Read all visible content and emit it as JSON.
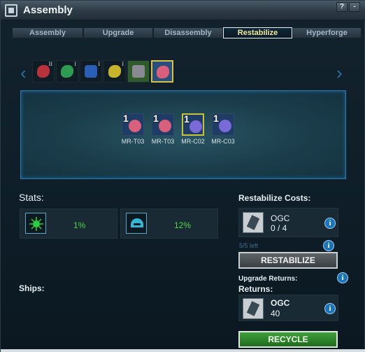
{
  "window": {
    "title": "Assembly",
    "help_label": "?",
    "minimize_label": "-"
  },
  "tabs": [
    {
      "label": "Assembly",
      "active": false
    },
    {
      "label": "Upgrade",
      "active": false
    },
    {
      "label": "Disassembly",
      "active": false
    },
    {
      "label": "Restabilize",
      "active": true
    },
    {
      "label": "Hyperforge",
      "active": false
    }
  ],
  "item_strip": {
    "items": [
      {
        "rank": "II",
        "icon": "red-module-icon",
        "color": "#b8323c"
      },
      {
        "rank": "I",
        "icon": "green-module-icon",
        "color": "#2e9a52"
      },
      {
        "rank": "I",
        "icon": "blue-engine-icon",
        "color": "#2a5fb8"
      },
      {
        "rank": "I",
        "icon": "yellow-module-icon",
        "color": "#c8b42a"
      },
      {
        "rank": "",
        "icon": "grey-turret-icon",
        "color": "#8a8a92"
      },
      {
        "rank": "",
        "icon": "pink-ring-module-icon",
        "color": "#d8607c",
        "selected": true
      }
    ]
  },
  "panel": {
    "items": [
      {
        "count": "1",
        "label": "MR-T03",
        "color": "#d8607c",
        "bg": "#1e3c66"
      },
      {
        "count": "1",
        "label": "MR-T03",
        "color": "#d8607c",
        "bg": "#1e3c66"
      },
      {
        "count": "1",
        "label": "MR-C02",
        "color": "#7a6ad8",
        "bg": "#1e3c66",
        "selected": true
      },
      {
        "count": "1",
        "label": "MR-C03",
        "color": "#7a6ad8",
        "bg": "#1e3c66"
      }
    ]
  },
  "stats": {
    "label": "Stats:",
    "items": [
      {
        "icon": "green-bug-icon",
        "value": "1%"
      },
      {
        "icon": "cyan-helmet-icon",
        "value": "12%"
      }
    ]
  },
  "ships_label": "Ships:",
  "restabilize_costs": {
    "heading": "Restabilize Costs:",
    "item_name": "OGC",
    "amount": "0 / 4",
    "left_text": "5/5 left",
    "button_label": "RESTABILIZE"
  },
  "returns": {
    "upgrade_returns_label": "Upgrade Returns:",
    "heading": "Returns:",
    "item_name": "OGC",
    "amount": "40",
    "button_label": "RECYCLE"
  },
  "info_glyph": "i"
}
